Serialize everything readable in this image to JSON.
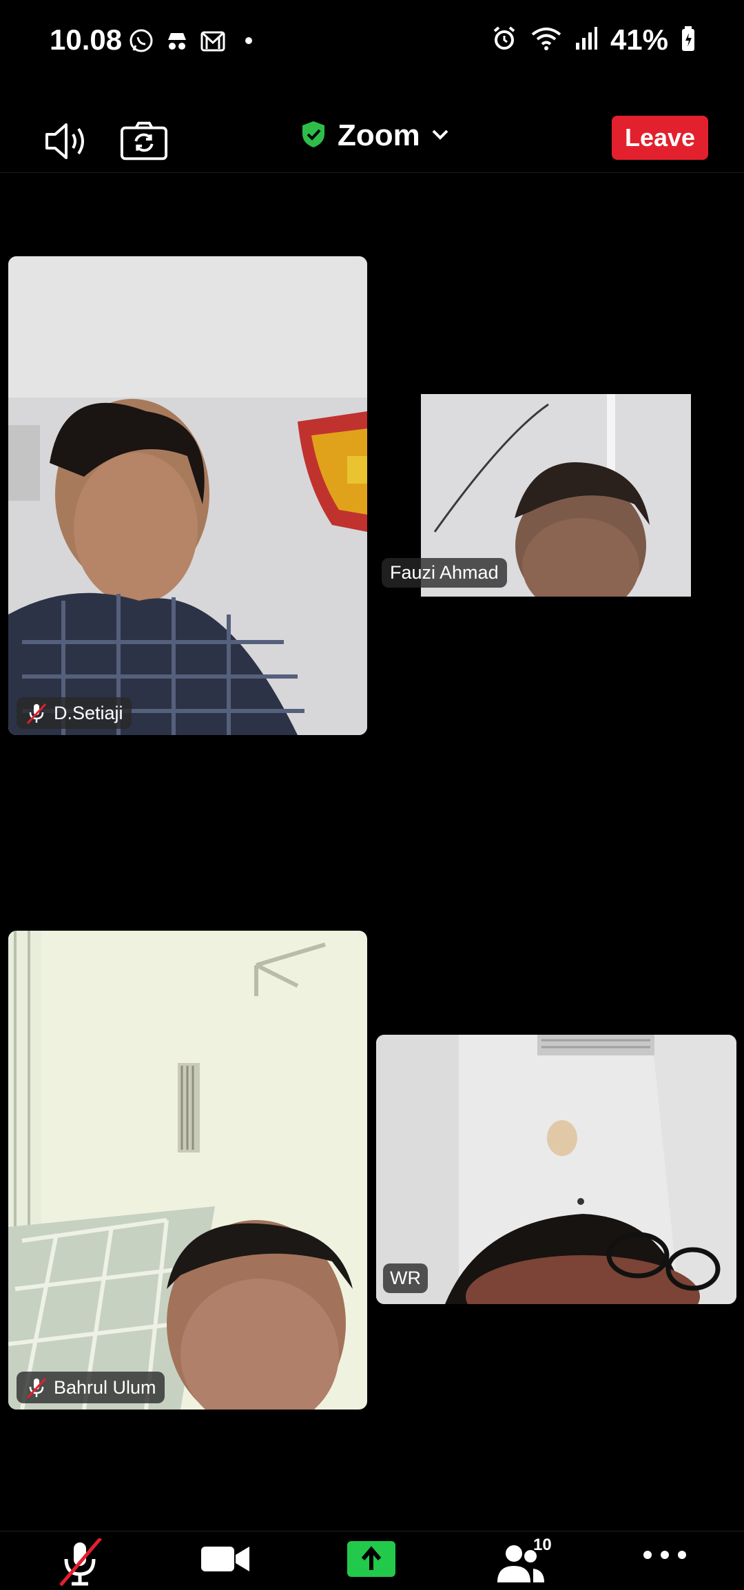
{
  "status_bar": {
    "time": "10.08",
    "battery": "41%",
    "app_icons": [
      "whatsapp-icon",
      "incognito-icon",
      "gmail-icon",
      "dot-icon"
    ],
    "right_icons": [
      "alarm-icon",
      "wifi-icon",
      "signal-icon",
      "battery-icon"
    ]
  },
  "top_bar": {
    "meeting_title": "Zoom",
    "leave_label": "Leave",
    "accent_shield": "#2fbd49",
    "leave_color": "#e3202d"
  },
  "participants": [
    {
      "name": "D.Setiaji",
      "muted": true
    },
    {
      "name": "Fauzi Ahmad",
      "muted": false
    },
    {
      "name": "Bahrul Ulum",
      "muted": true
    },
    {
      "name": "WR",
      "muted": false
    }
  ],
  "toolbar": {
    "participant_count": "10",
    "share_color": "#22c94a",
    "items": [
      "mute-mic-icon",
      "video-camera-icon",
      "share-screen-icon",
      "participants-icon",
      "more-icon"
    ]
  }
}
